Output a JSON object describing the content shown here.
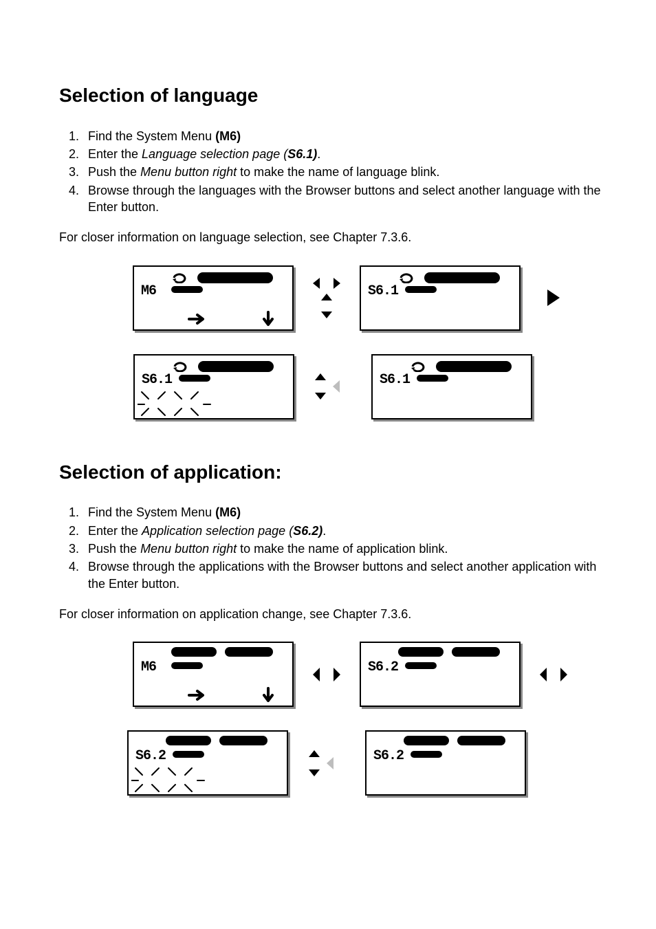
{
  "section1": {
    "heading": "Selection of language",
    "steps": [
      {
        "pre": "Find the System Menu ",
        "bold": "(M6)",
        "post": ""
      },
      {
        "pre": "Enter the ",
        "ital": "Language selection page (",
        "ibold": "S6.1)",
        "post": "."
      },
      {
        "pre": "Push the ",
        "ital": "Menu button right",
        "post": " to make the name of language blink."
      },
      {
        "pre": "Browse through the languages with the Browser buttons and select another language with the Enter button.",
        "ital": "",
        "post": ""
      }
    ],
    "note": "For closer information on language selection, see Chapter 7.3.6.",
    "panels": [
      {
        "code": "M6"
      },
      {
        "code": "S6.1"
      },
      {
        "code": "S6.1"
      },
      {
        "code": "S6.1"
      }
    ]
  },
  "section2": {
    "heading": "Selection of application:",
    "steps": [
      {
        "pre": "Find the System Menu ",
        "bold": "(M6)",
        "post": ""
      },
      {
        "pre": "Enter the ",
        "ital": "Application selection page (",
        "ibold": "S6.2)",
        "post": "."
      },
      {
        "pre": "Push the ",
        "ital": "Menu button right",
        "post": " to make the name of application blink."
      },
      {
        "pre": "Browse through the applications with the Browser buttons and select another application with the Enter button.",
        "ital": "",
        "post": ""
      }
    ],
    "note": "For closer information on application change, see Chapter 7.3.6.",
    "panels": [
      {
        "code": "M6"
      },
      {
        "code": "S6.2"
      },
      {
        "code": "S6.2"
      },
      {
        "code": "S6.2"
      }
    ]
  }
}
